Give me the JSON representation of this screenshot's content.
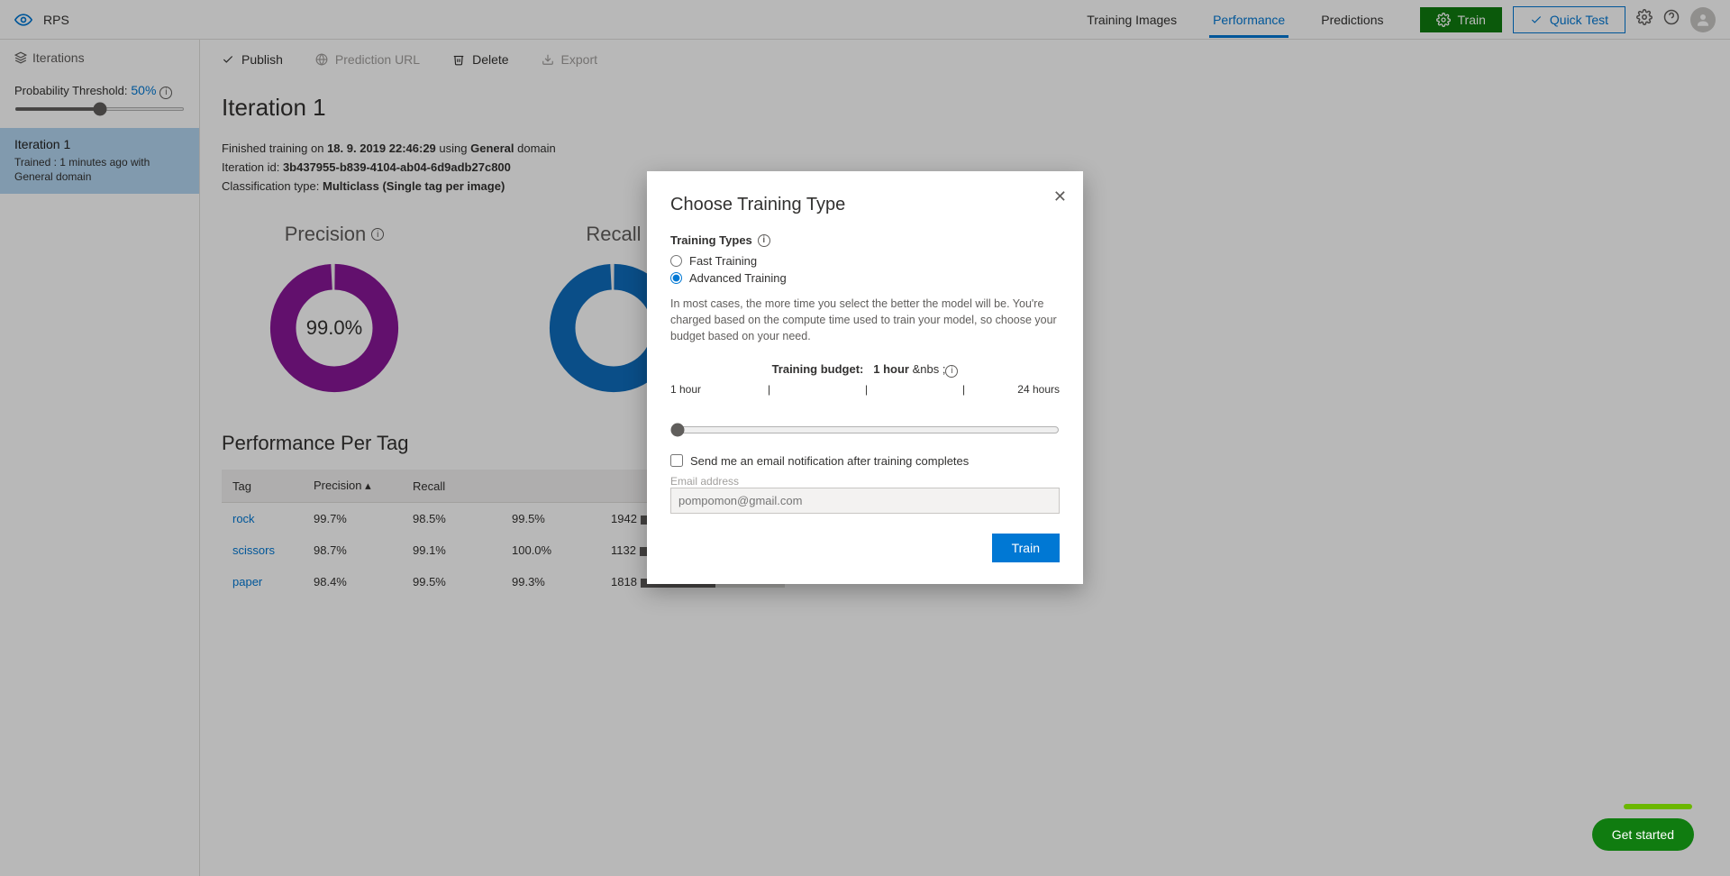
{
  "header": {
    "project_name": "RPS",
    "nav": {
      "training_images": "Training Images",
      "performance": "Performance",
      "predictions": "Predictions"
    },
    "train_btn": "Train",
    "quick_test_btn": "Quick Test"
  },
  "sidebar": {
    "iterations_label": "Iterations",
    "threshold_label": "Probability Threshold:",
    "threshold_value": "50%",
    "item": {
      "title": "Iteration 1",
      "sub": "Trained : 1 minutes ago with General domain"
    }
  },
  "toolbar": {
    "publish": "Publish",
    "prediction_url": "Prediction URL",
    "delete": "Delete",
    "export": "Export"
  },
  "page": {
    "title": "Iteration 1",
    "finished_pre": "Finished training on ",
    "finished_date": "18. 9. 2019 22:46:29",
    "finished_mid": " using ",
    "finished_domain": "General",
    "finished_post": " domain",
    "iter_pre": "Iteration id: ",
    "iter_id": "3b437955-b839-4104-ab04-6d9adb27c800",
    "class_pre": "Classification type: ",
    "class_val": "Multiclass (Single tag per image)"
  },
  "chart_data": [
    {
      "type": "pie",
      "title": "Precision",
      "value_label": "99.0%",
      "values": [
        99.0,
        1.0
      ],
      "color": "#881798"
    },
    {
      "type": "pie",
      "title": "Recall",
      "value_label": "",
      "values": [
        99.0,
        1.0
      ],
      "color": "#0f6cbd"
    }
  ],
  "perf": {
    "title": "Performance Per Tag",
    "columns": {
      "tag": "Tag",
      "precision": "Precision",
      "recall": "Recall",
      "ap": "",
      "count": ""
    },
    "rows": [
      {
        "tag": "rock",
        "precision": "99.7%",
        "recall": "98.5%",
        "ap": "99.5%",
        "count": "1942",
        "bar_pct": 30
      },
      {
        "tag": "scissors",
        "precision": "98.7%",
        "recall": "99.1%",
        "ap": "100.0%",
        "count": "1132",
        "bar_pct": 28
      },
      {
        "tag": "paper",
        "precision": "98.4%",
        "recall": "99.5%",
        "ap": "99.3%",
        "count": "1818",
        "bar_pct": 52
      }
    ]
  },
  "modal": {
    "title": "Choose Training Type",
    "section_label": "Training Types",
    "opt_fast": "Fast Training",
    "opt_adv": "Advanced Training",
    "help": "In most cases, the more time you select the better the model will be. You're charged based on the compute time used to train your model, so choose your budget based on your need.",
    "budget_label": "Training budget:",
    "budget_value": "1 hour",
    "scale_min": "1 hour",
    "scale_max": "24 hours",
    "cb_label": "Send me an email notification after training completes",
    "email_label": "Email address",
    "email_placeholder": "pompomon@gmail.com",
    "train_btn": "Train"
  },
  "footer": {
    "get_started": "Get started"
  }
}
